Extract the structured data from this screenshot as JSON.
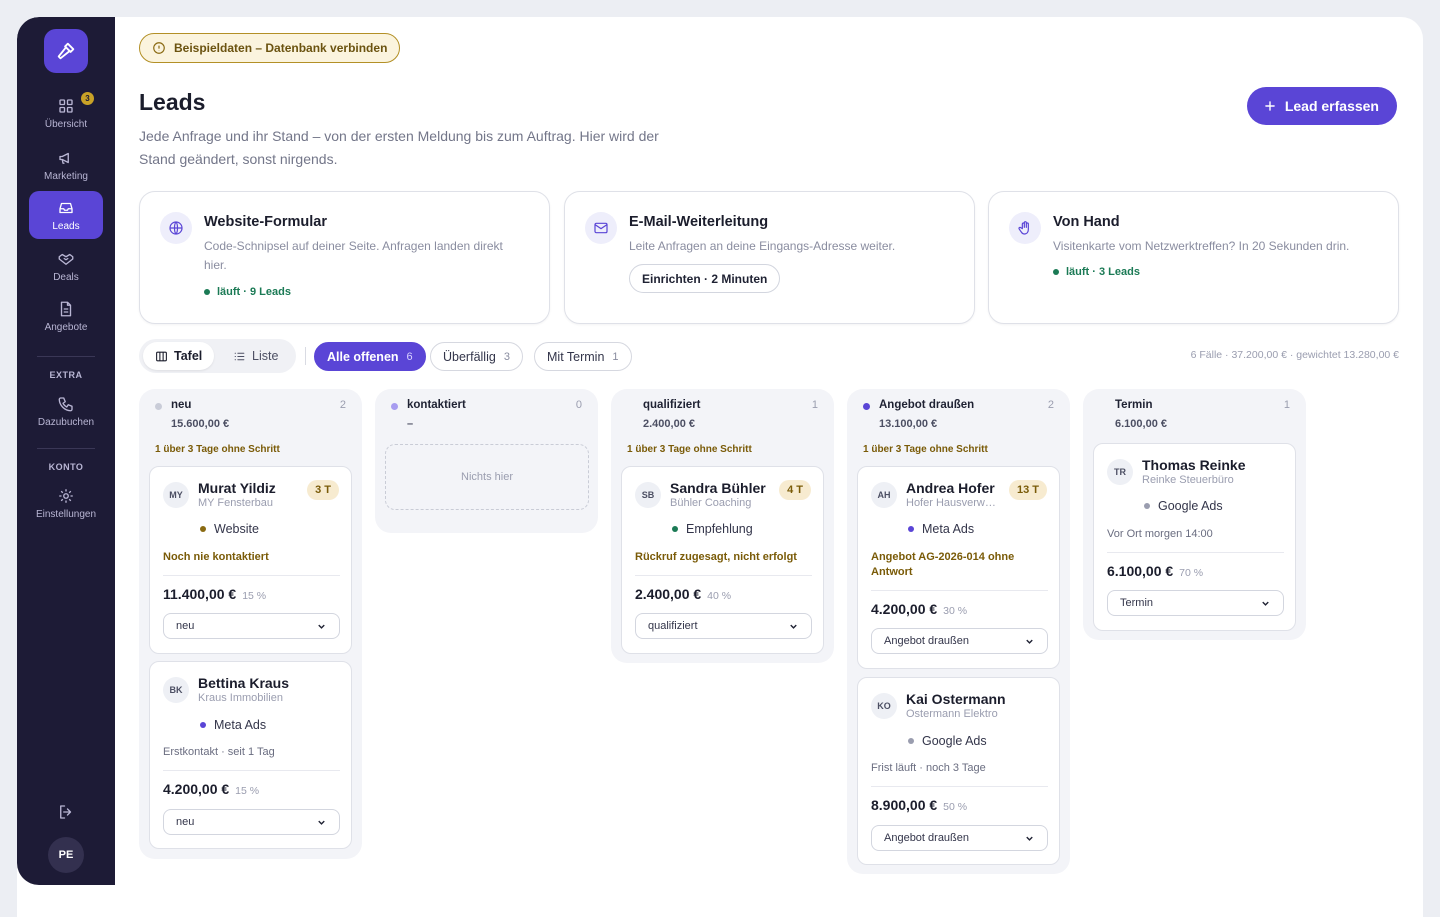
{
  "nav": {
    "items": [
      {
        "label": "Übersicht",
        "badge": "3",
        "icon": "grid-icon"
      },
      {
        "label": "Marketing",
        "icon": "megaphone-icon"
      },
      {
        "label": "Leads",
        "icon": "inbox-icon",
        "active": true
      },
      {
        "label": "Deals",
        "icon": "handshake-icon"
      },
      {
        "label": "Angebote",
        "icon": "document-icon"
      }
    ],
    "extra_heading": "EXTRA",
    "extra_item": {
      "label": "Dazubuchen",
      "icon": "phone-icon"
    },
    "account_heading": "KONTO",
    "account_item": {
      "label": "Einstellungen",
      "icon": "gear-icon"
    },
    "user_initials": "PE"
  },
  "banner": {
    "text": "Beispieldaten – Datenbank verbinden"
  },
  "header": {
    "title": "Leads",
    "subtitle": "Jede Anfrage und ihr Stand – von der ersten Meldung bis zum Auftrag. Hier wird der Stand geändert, sonst nirgends.",
    "primary_button": "Lead erfassen"
  },
  "sources": [
    {
      "title": "Website-Formular",
      "desc": "Code-Schnipsel auf deiner Seite. Anfragen landen direkt hier.",
      "status": "läuft · 9 Leads",
      "icon": "globe-icon"
    },
    {
      "title": "E-Mail-Weiterleitung",
      "desc": "Leite Anfragen an deine Eingangs-Adresse weiter.",
      "button": "Einrichten · 2 Minuten",
      "icon": "mail-icon"
    },
    {
      "title": "Von Hand",
      "desc": "Visitenkarte vom Netzwerktreffen? In 20 Sekunden drin.",
      "status": "läuft · 3 Leads",
      "icon": "hand-icon"
    }
  ],
  "toolbar": {
    "view_board": "Tafel",
    "view_list": "Liste",
    "filters": [
      {
        "label": "Alle offenen",
        "count": "6"
      },
      {
        "label": "Überfällig",
        "count": "3"
      },
      {
        "label": "Mit Termin",
        "count": "1"
      }
    ],
    "summary": "6 Fälle · 37.200,00 € · gewichtet 13.280,00 €"
  },
  "colors": {
    "accent": "#5a45d6",
    "sidebar": "#1d1b36",
    "warn": "#7a5b08",
    "ok": "#1b7a55"
  },
  "columns": [
    {
      "name": "neu",
      "count": "2",
      "sum": "15.600,00 €",
      "warn": "1 über 3 Tage ohne Schritt",
      "dot": "#c9ccd8"
    },
    {
      "name": "kontaktiert",
      "count": "0",
      "sum": "–",
      "empty": "Nichts hier",
      "dot": "#a79cf0"
    },
    {
      "name": "qualifiziert",
      "count": "1",
      "sum": "2.400,00 €",
      "warn": "1 über 3 Tage ohne Schritt",
      "dot": ""
    },
    {
      "name": "Angebot draußen",
      "count": "2",
      "sum": "13.100,00 €",
      "warn": "1 über 3 Tage ohne Schritt",
      "dot": "#5a45d6"
    },
    {
      "name": "Termin",
      "count": "1",
      "sum": "6.100,00 €",
      "dot": ""
    }
  ],
  "cards": [
    {
      "initials": "MY",
      "name": "Murat Yildiz",
      "company": "MY Fensterbau",
      "age": "3 T",
      "source": "Website",
      "source_color": "#8a6a12",
      "note": "Noch nie kontaktiert",
      "value": "11.400,00 €",
      "pct": "15 %",
      "stage": "neu"
    },
    {
      "initials": "BK",
      "name": "Bettina Kraus",
      "company": "Kraus Immobilien",
      "source": "Meta Ads",
      "source_color": "#5a45d6",
      "note": "Erstkontakt · seit 1 Tag",
      "value": "4.200,00 €",
      "pct": "15 %",
      "stage": "neu"
    },
    {
      "initials": "SB",
      "name": "Sandra Bühler",
      "company": "Bühler Coaching",
      "age": "4 T",
      "source": "Empfehlung",
      "source_color": "#1b7a55",
      "note": "Rückruf zugesagt, nicht erfolgt",
      "value": "2.400,00 €",
      "pct": "40 %",
      "stage": "qualifiziert"
    },
    {
      "initials": "AH",
      "name": "Andrea Hofer",
      "company": "Hofer Hausverwaltung",
      "age": "13 T",
      "source": "Meta Ads",
      "source_color": "#5a45d6",
      "note": "Angebot AG-2026-014 ohne Antwort",
      "value": "4.200,00 €",
      "pct": "30 %",
      "stage": "Angebot draußen"
    },
    {
      "initials": "KO",
      "name": "Kai Ostermann",
      "company": "Ostermann Elektro",
      "source": "Google Ads",
      "source_color": "#9a9daf",
      "note": "Frist läuft · noch 3 Tage",
      "value": "8.900,00 €",
      "pct": "50 %",
      "stage": "Angebot draußen"
    },
    {
      "initials": "TR",
      "name": "Thomas Reinke",
      "company": "Reinke Steuerbüro",
      "source": "Google Ads",
      "source_color": "#9a9daf",
      "note": "Vor Ort morgen 14:00",
      "value": "6.100,00 €",
      "pct": "70 %",
      "stage": "Termin"
    }
  ]
}
